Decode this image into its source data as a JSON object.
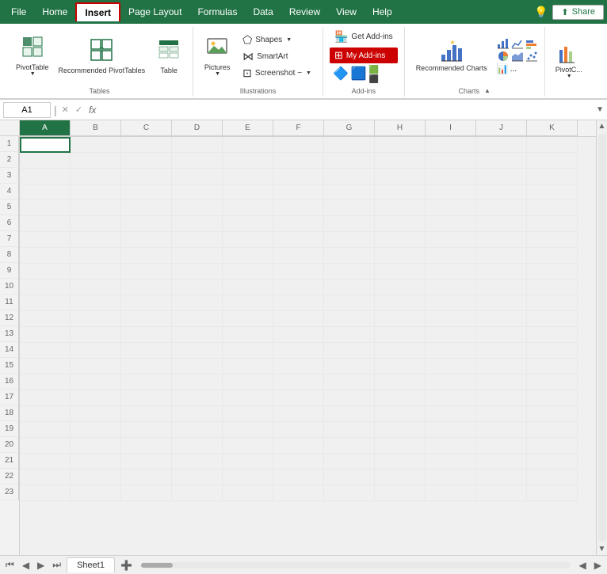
{
  "ribbon": {
    "tabs": [
      {
        "id": "file",
        "label": "File"
      },
      {
        "id": "home",
        "label": "Home"
      },
      {
        "id": "insert",
        "label": "Insert",
        "active": true
      },
      {
        "id": "page-layout",
        "label": "Page Layout"
      },
      {
        "id": "formulas",
        "label": "Formulas"
      },
      {
        "id": "data",
        "label": "Data"
      },
      {
        "id": "review",
        "label": "Review"
      },
      {
        "id": "view",
        "label": "View"
      },
      {
        "id": "help",
        "label": "Help"
      }
    ],
    "share_button": "Share",
    "groups": {
      "tables": {
        "label": "Tables",
        "pivot_table": "PivotTable",
        "recommended_pivottables": "Recommended\nPivotTables",
        "table": "Table"
      },
      "illustrations": {
        "label": "Illustrations",
        "pictures": "Pictures",
        "shapes": "Shapes",
        "smartart": "SmartArt",
        "screenshot": "Screenshot ~"
      },
      "addins": {
        "label": "Add-ins",
        "get_addins": "Get Add-ins",
        "my_addins": "My Add-ins"
      },
      "charts": {
        "label": "Charts",
        "recommended_charts": "Recommended\nCharts",
        "collapse": "▲"
      }
    }
  },
  "formula_bar": {
    "cell_ref": "A1",
    "cancel": "✕",
    "confirm": "✓",
    "fx": "fx"
  },
  "columns": [
    "A",
    "B",
    "C",
    "D",
    "E",
    "F",
    "G",
    "H",
    "I",
    "J",
    "K"
  ],
  "rows": [
    1,
    2,
    3,
    4,
    5,
    6,
    7,
    8,
    9,
    10,
    11,
    12,
    13,
    14,
    15,
    16,
    17,
    18,
    19,
    20,
    21,
    22,
    23
  ],
  "sheet_tabs": [
    {
      "label": "Sheet1",
      "active": true
    }
  ]
}
